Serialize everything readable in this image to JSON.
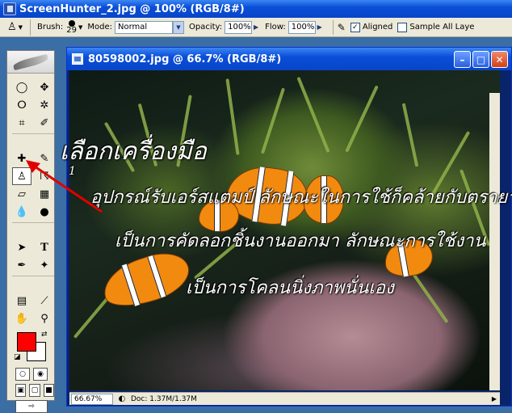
{
  "app": {
    "title": "ScreenHunter_2.jpg @ 100% (RGB/8#)"
  },
  "options": {
    "brush_label": "Brush:",
    "brush_size": "29",
    "mode_label": "Mode:",
    "mode_value": "Normal",
    "opacity_label": "Opacity:",
    "opacity_value": "100%",
    "flow_label": "Flow:",
    "flow_value": "100%",
    "aligned_label": "Aligned",
    "aligned_checked": true,
    "sample_all_label": "Sample All Laye",
    "sample_all_checked": false
  },
  "colors": {
    "foreground": "#ff0000",
    "background": "#ffffff",
    "accent": "#0a4fd8"
  },
  "document": {
    "title": "80598002.jpg @ 66.7% (RGB/8#)",
    "annotation_heading": "เลือกเครื่องมือ",
    "annotation_number": "1",
    "annotation_line1": "อุปกรณ์รับเอร์สแตมป์ ลักษณะในการใช้ก็คล้ายกับตรายาง",
    "annotation_line2": "เป็นการคัดลอกชิ้นงานออกมา ลักษณะการใช้งาน",
    "annotation_line3": "เป็นการโคลนนิ่งภาพนั่นเอง"
  },
  "status": {
    "zoom": "66.67%",
    "doc_info": "Doc: 1.37M/1.37M"
  }
}
